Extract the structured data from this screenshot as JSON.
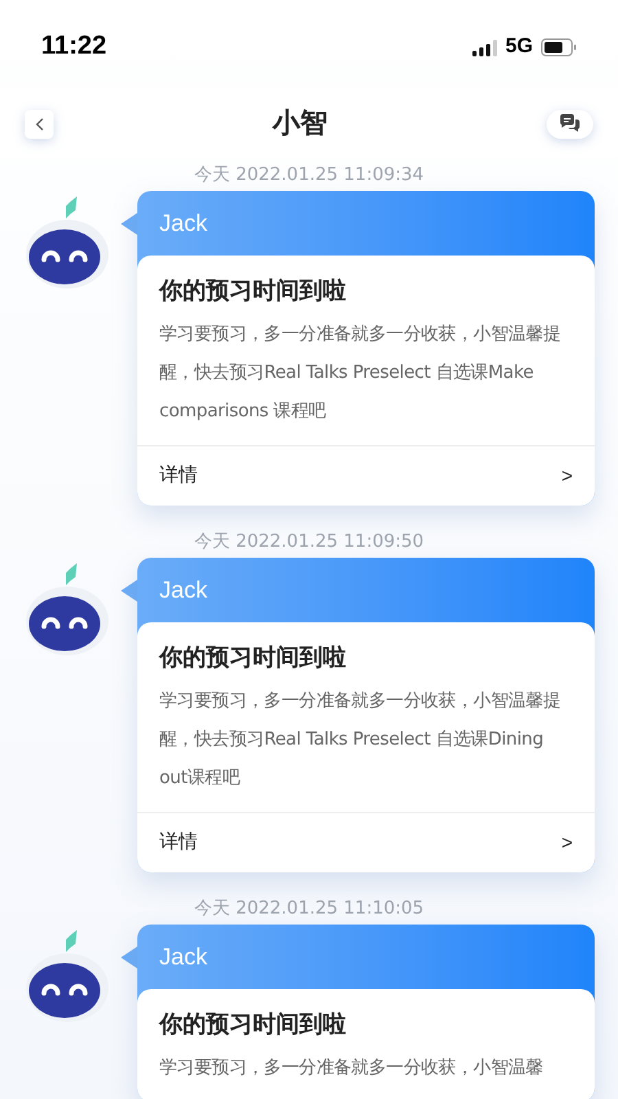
{
  "status_bar": {
    "time": "11:22",
    "network": "5G"
  },
  "header": {
    "title": "小智"
  },
  "messages": [
    {
      "timestamp": "今天 2022.01.25 11:09:34",
      "sender": "Jack",
      "title": "你的预习时间到啦",
      "body": "学习要预习，多一分准备就多一分收获，小智温馨提醒，快去预习Real Talks Preselect 自选课Make comparisons 课程吧",
      "link": "详情",
      "arrow": ">"
    },
    {
      "timestamp": "今天 2022.01.25 11:09:50",
      "sender": "Jack",
      "title": "你的预习时间到啦",
      "body": "学习要预习，多一分准备就多一分收获，小智温馨提醒，快去预习Real Talks Preselect 自选课Dining out课程吧",
      "link": "详情",
      "arrow": ">"
    },
    {
      "timestamp": "今天 2022.01.25 11:10:05",
      "sender": "Jack",
      "title": "你的预习时间到啦",
      "body": "学习要预习，多一分准备就多一分收获，小智温馨"
    }
  ]
}
